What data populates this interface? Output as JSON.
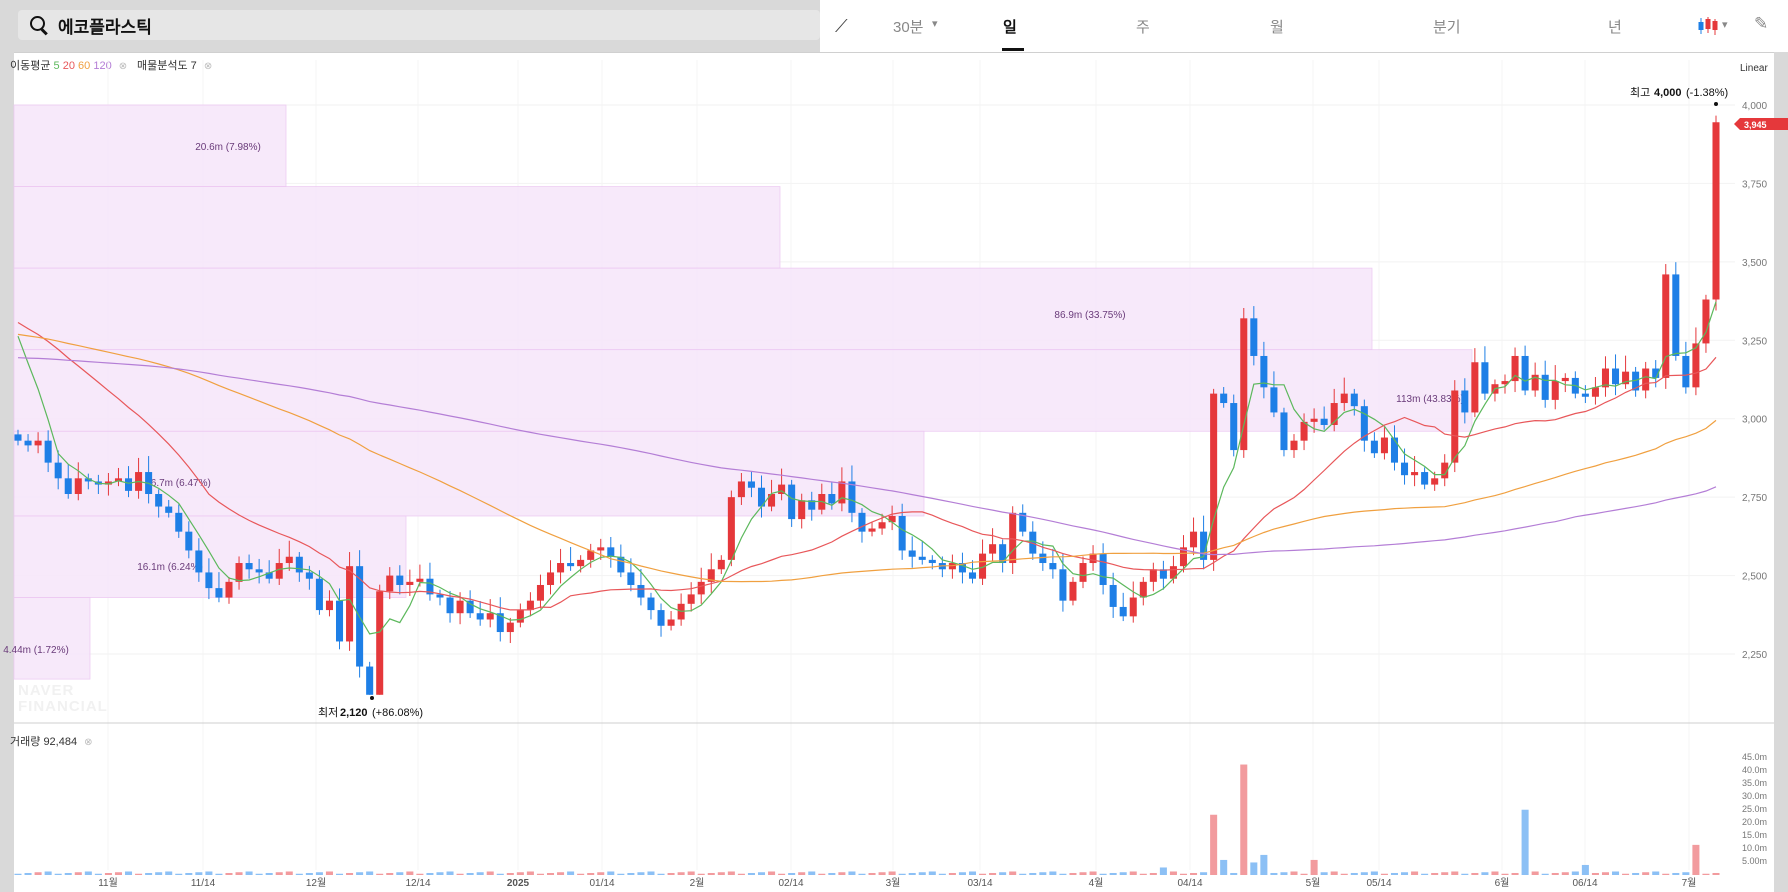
{
  "search": {
    "query": "에코플라스틱"
  },
  "toolbar": {
    "interval": "30분",
    "tabs": [
      "일",
      "주",
      "월",
      "분기",
      "년"
    ],
    "active_tab": "일"
  },
  "legend": {
    "ma_label": "이동평균",
    "ma_periods": [
      "5",
      "20",
      "60",
      "120"
    ],
    "vp_label": "매물분석도",
    "vp_value": "7",
    "volume_label": "거래량",
    "volume_value": "92,484"
  },
  "scale": "Linear",
  "watermark": [
    "NAVER",
    "FINANCIAL"
  ],
  "colors": {
    "up": "#e5383b",
    "down": "#1e7fe6",
    "ma5": "#5cb85c",
    "ma20": "#e8575a",
    "ma60": "#f0a040",
    "ma120": "#b47ed6",
    "vp_fill": "#f7e7fa",
    "vp_border": "#ecc7f2"
  },
  "chart_data": {
    "type": "candlestick",
    "price_axis": {
      "ticks": [
        "4,000",
        "3,750",
        "3,500",
        "3,250",
        "3,000",
        "2,750",
        "2,500",
        "2,250"
      ],
      "range": [
        2120,
        4000
      ]
    },
    "x_labels": [
      "11월",
      "11/14",
      "12월",
      "12/14",
      "2025",
      "01/14",
      "2월",
      "02/14",
      "3월",
      "03/14",
      "4월",
      "04/14",
      "5월",
      "05/14",
      "6월",
      "06/14",
      "7월"
    ],
    "high_annotation": {
      "prefix": "최고",
      "value": "4,000",
      "change": "(-1.38%)"
    },
    "low_annotation": {
      "prefix": "최저",
      "value": "2,120",
      "change": "(+86.08%)"
    },
    "current_price": "3,945",
    "volume_profile": [
      {
        "label": "20.6m (7.98%)",
        "low": 3740,
        "high": 4000
      },
      {
        "label": "86.9m (33.75%)",
        "low": 3480,
        "high": 3740
      },
      {
        "label": "113m (43.83%)",
        "low": 3220,
        "high": 3480
      },
      {
        "label": "",
        "low": 2960,
        "high": 3220
      },
      {
        "label": "16.7m (6.47%)",
        "low": 2690,
        "high": 2960
      },
      {
        "label": "16.1m (6.24%)",
        "low": 2430,
        "high": 2690
      },
      {
        "label": "4.44m (1.72%)",
        "low": 2170,
        "high": 2430
      }
    ],
    "volume_axis": {
      "ticks": [
        "45.0m",
        "40.0m",
        "35.0m",
        "30.0m",
        "25.0m",
        "20.0m",
        "15.0m",
        "10.0m",
        "5.00m"
      ],
      "max": 47
    },
    "moving_average_periods": [
      5,
      20,
      60,
      120
    ]
  }
}
